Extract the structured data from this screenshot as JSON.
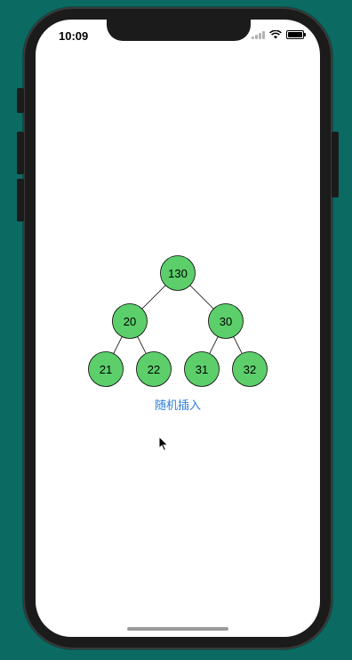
{
  "status_bar": {
    "time": "10:09"
  },
  "tree": {
    "root": {
      "label": "130"
    },
    "left": {
      "label": "20"
    },
    "right": {
      "label": "30"
    },
    "left_left": {
      "label": "21"
    },
    "left_right": {
      "label": "22"
    },
    "right_left": {
      "label": "31"
    },
    "right_right": {
      "label": "32"
    },
    "node_color": "#5ccf6b",
    "stroke_color": "#000000"
  },
  "actions": {
    "random_insert_label": "随机插入",
    "link_color": "#2d7ed8"
  }
}
